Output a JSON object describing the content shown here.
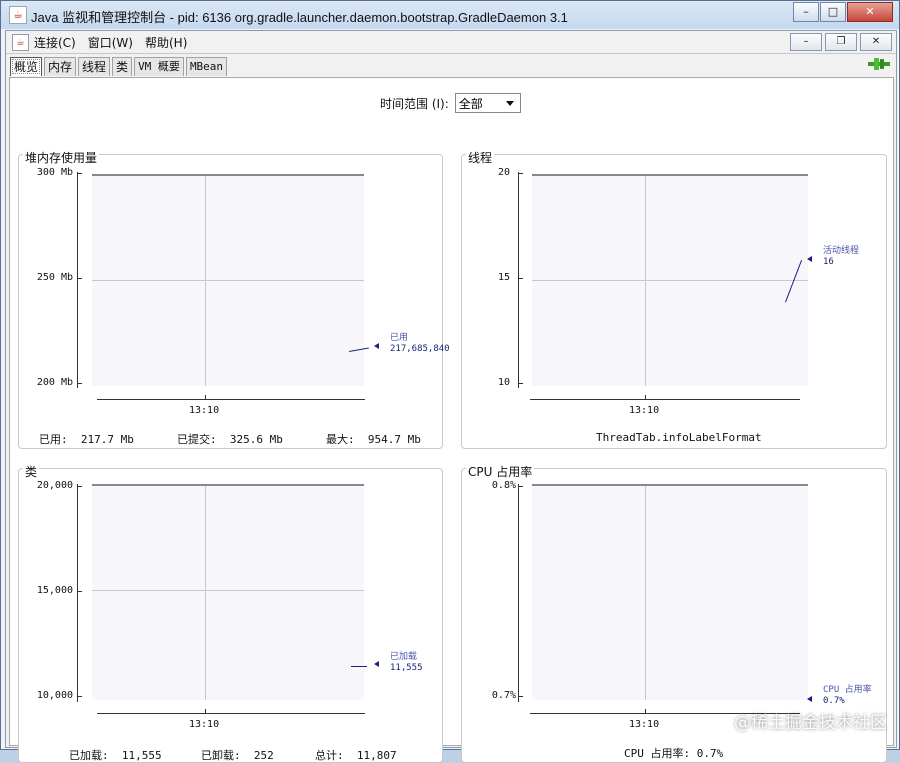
{
  "window": {
    "title": "Java 监视和管理控制台 - pid: 6136 org.gradle.launcher.daemon.bootstrap.GradleDaemon 3.1",
    "controls": {
      "minimize": "–",
      "maximize": "□",
      "close": "✕"
    }
  },
  "menu": {
    "items": [
      "连接(C)",
      "窗口(W)",
      "帮助(H)"
    ],
    "inner_controls": {
      "minimize": "–",
      "restore": "❐",
      "close": "✕"
    }
  },
  "tabs": [
    "概览",
    "内存",
    "线程",
    "类",
    "VM 概要",
    "MBean"
  ],
  "toolbar": {
    "time_range_label": "时间范围 (I):",
    "time_range_value": "全部"
  },
  "panels": {
    "heap": {
      "title": "堆内存使用量",
      "y_ticks": [
        "300 Mb",
        "250 Mb",
        "200 Mb"
      ],
      "x_tick": "13:10",
      "legend_name": "已用",
      "legend_value": "217,685,840",
      "stats": [
        {
          "label": "已用:",
          "value": "217.7 Mb"
        },
        {
          "label": "已提交:",
          "value": "325.6 Mb"
        },
        {
          "label": "最大:",
          "value": "954.7 Mb"
        }
      ]
    },
    "threads": {
      "title": "线程",
      "y_ticks": [
        "20",
        "15",
        "10"
      ],
      "x_tick": "13:10",
      "legend_name": "活动线程",
      "legend_value": "16",
      "footer": "ThreadTab.infoLabelFormat"
    },
    "classes": {
      "title": "类",
      "y_ticks": [
        "20,000",
        "15,000",
        "10,000"
      ],
      "x_tick": "13:10",
      "legend_name": "已加载",
      "legend_value": "11,555",
      "stats": [
        {
          "label": "已加载:",
          "value": "11,555"
        },
        {
          "label": "已卸载:",
          "value": "252"
        },
        {
          "label": "总计:",
          "value": "11,807"
        }
      ]
    },
    "cpu": {
      "title": "CPU 占用率",
      "y_ticks": [
        "0.8%",
        "0.7%"
      ],
      "x_tick": "13:10",
      "legend_name": "CPU 占用率",
      "legend_value": "0.7%",
      "footer": "CPU 占用率: 0.7%"
    }
  },
  "chart_data": [
    {
      "type": "line",
      "title": "堆内存使用量",
      "ylim": [
        200,
        300
      ],
      "yunit": "Mb",
      "x": [
        "13:10"
      ],
      "series": [
        {
          "name": "已用",
          "values": [
            217.7
          ]
        }
      ]
    },
    {
      "type": "line",
      "title": "线程",
      "ylim": [
        10,
        20
      ],
      "x": [
        "13:10"
      ],
      "series": [
        {
          "name": "活动线程",
          "values": [
            14,
            16
          ]
        }
      ]
    },
    {
      "type": "line",
      "title": "类",
      "ylim": [
        10000,
        20000
      ],
      "x": [
        "13:10"
      ],
      "series": [
        {
          "name": "已加载",
          "values": [
            11555
          ]
        }
      ]
    },
    {
      "type": "line",
      "title": "CPU 占用率",
      "ylim": [
        0.7,
        0.8
      ],
      "yunit": "%",
      "x": [
        "13:10"
      ],
      "series": [
        {
          "name": "CPU 占用率",
          "values": [
            0.7
          ]
        }
      ]
    }
  ],
  "colors": {
    "series": "#1a237e",
    "plot_bg": "#f7f7fb"
  },
  "watermark": "@稀土掘金技术社区"
}
